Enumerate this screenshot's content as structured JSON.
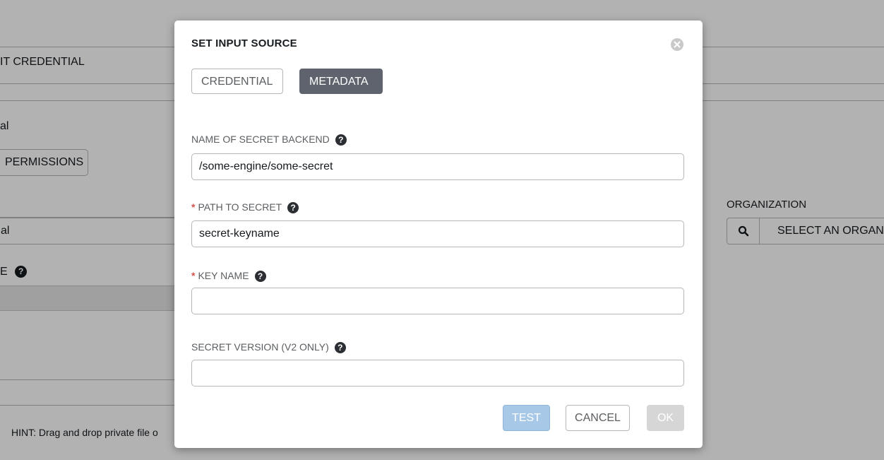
{
  "background": {
    "form_title": "IT CREDENTIAL",
    "name_label": "al",
    "permissions_button": "PERMISSIONS",
    "name_value": "al",
    "type_label": "E",
    "organization_label": "ORGANIZATION",
    "organization_placeholder": "SELECT AN ORGANIZ",
    "hint": "HINT: Drag and drop private file o"
  },
  "modal": {
    "title": "SET INPUT SOURCE",
    "tabs": [
      {
        "label": "CREDENTIAL",
        "active": false
      },
      {
        "label": "METADATA",
        "active": true
      }
    ],
    "fields": {
      "secret_backend": {
        "label": "NAME OF SECRET BACKEND",
        "required": false,
        "value": "/some-engine/some-secret"
      },
      "secret_path": {
        "label": "PATH TO SECRET",
        "required": true,
        "value": "secret-keyname"
      },
      "key_name": {
        "label": "KEY NAME",
        "required": true,
        "value": ""
      },
      "secret_version": {
        "label": "SECRET VERSION (V2 ONLY)",
        "required": false,
        "value": ""
      }
    },
    "required_marker": "*",
    "help_glyph": "?",
    "buttons": {
      "test": "TEST",
      "cancel": "CANCEL",
      "ok": "OK"
    }
  },
  "icons": {
    "close": "close-circle-icon",
    "help": "question-circle-icon",
    "search": "search-icon"
  },
  "colors": {
    "active_tab": "#5e636e",
    "test_button": "#a8c8e8",
    "ok_button_disabled": "#d6d6d6",
    "required": "#d9534f"
  }
}
